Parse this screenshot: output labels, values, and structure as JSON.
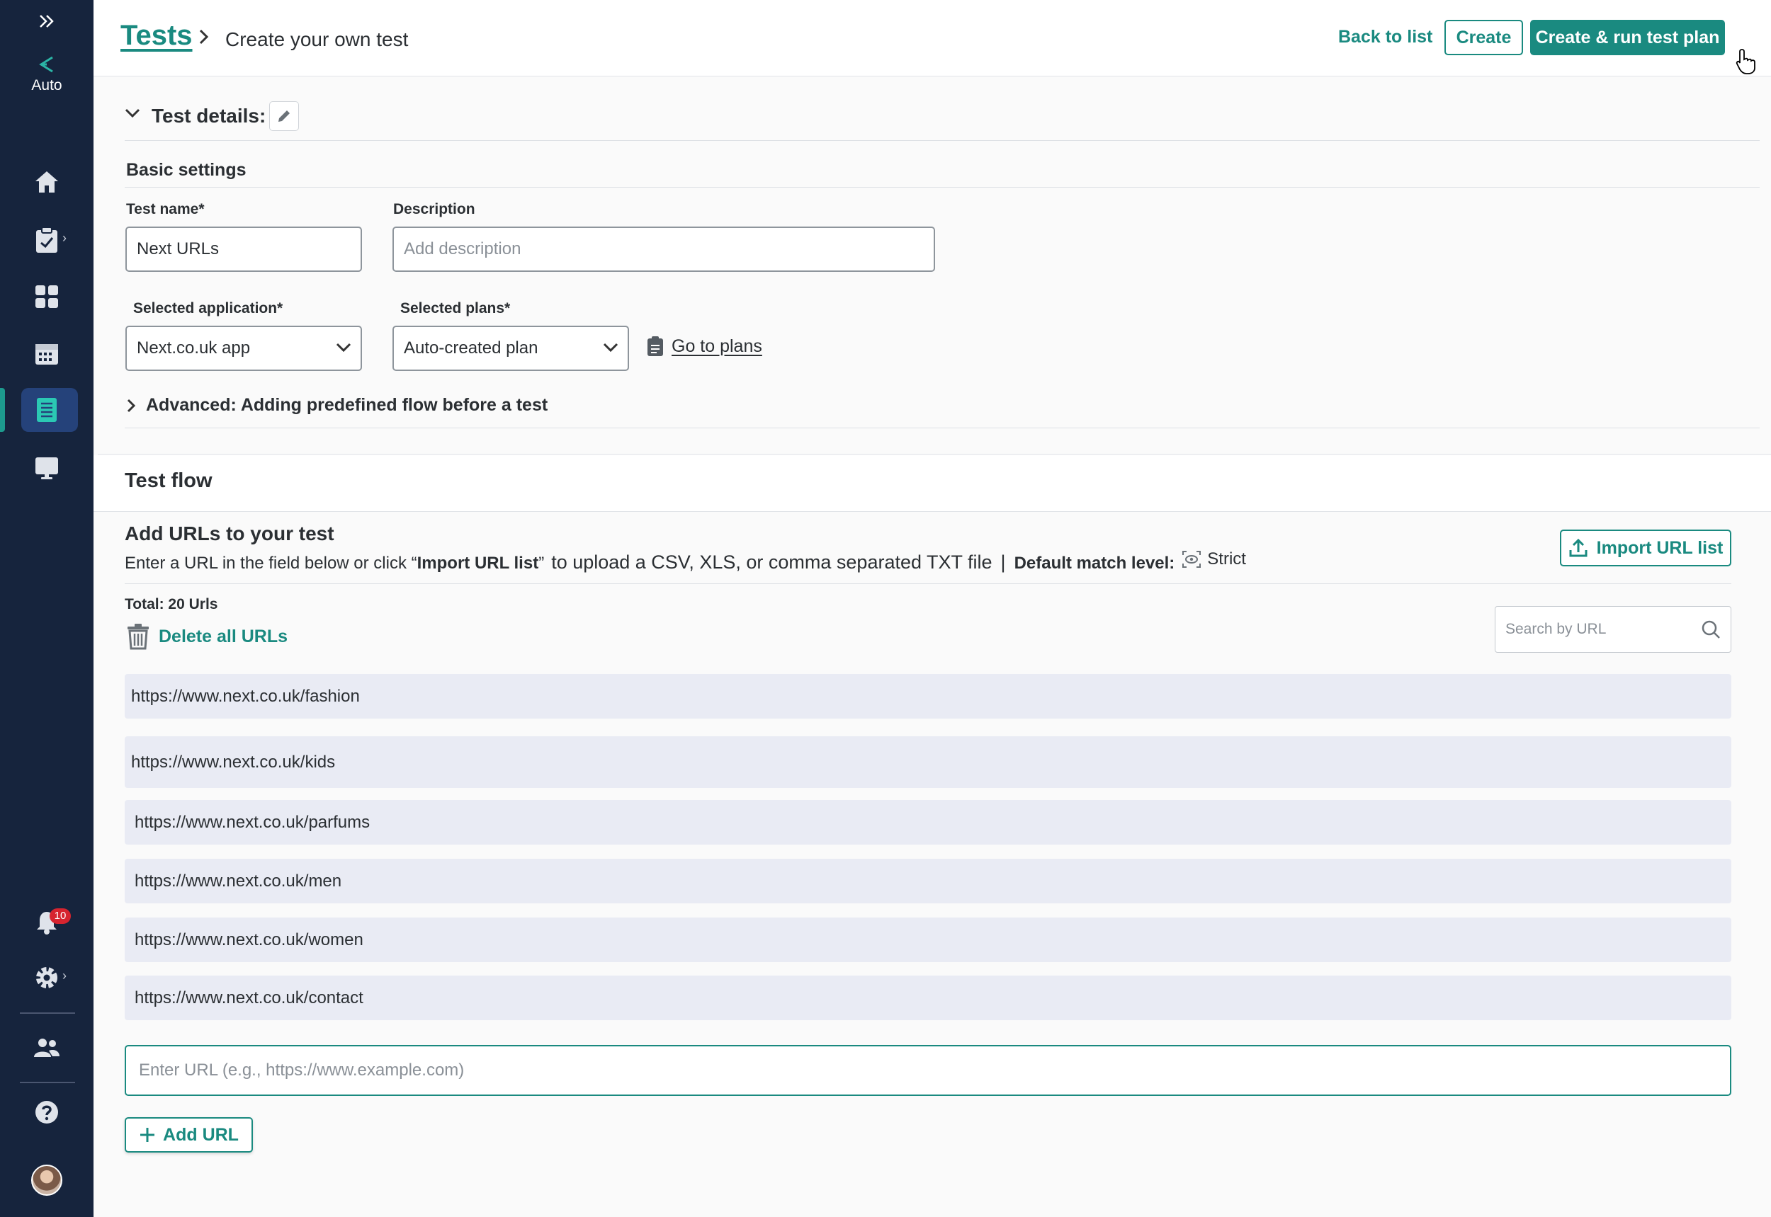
{
  "sidebar": {
    "expand_icon": "double-chevron-right-icon",
    "auto_label": "Auto",
    "notification_count": "10",
    "items": [
      {
        "icon": "home-icon"
      },
      {
        "icon": "clipboard-check-icon"
      },
      {
        "icon": "dashboard-grid-icon"
      },
      {
        "icon": "calendar-icon"
      },
      {
        "icon": "list-document-icon",
        "active": true
      },
      {
        "icon": "monitor-icon"
      }
    ],
    "bottom": [
      {
        "icon": "bell-icon"
      },
      {
        "icon": "gear-icon"
      },
      {
        "icon": "users-icon"
      },
      {
        "icon": "help-icon"
      },
      {
        "icon": "avatar"
      }
    ]
  },
  "header": {
    "breadcrumb_root": "Tests",
    "breadcrumb_current": "Create your own test",
    "back_label": "Back to list",
    "create_label": "Create",
    "create_run_label": "Create & run test plan"
  },
  "details": {
    "title": "Test details:",
    "basic_settings": "Basic settings",
    "test_name_label": "Test name*",
    "test_name_value": "Next URLs",
    "description_label": "Description",
    "description_placeholder": "Add description",
    "app_label": "Selected application*",
    "app_value": "Next.co.uk app",
    "plans_label": "Selected plans*",
    "plans_value": "Auto-created plan",
    "go_to_plans": "Go to plans",
    "advanced": "Advanced: Adding predefined flow before a test"
  },
  "flow": {
    "title": "Test flow",
    "add_title": "Add  URLs to your test",
    "instr_part1": "Enter a URL in the field below  or click “",
    "instr_bold": "Import URL list",
    "instr_part2": "”",
    "instr_part3": "to upload a CSV, XLS, or comma separated TXT file",
    "pipe": "|",
    "match_label": "Default match level:",
    "match_value": "Strict",
    "import_label": "Import URL list",
    "total": "Total: 20 Urls",
    "delete_all": "Delete all URLs",
    "search_placeholder": "Search by URL",
    "urls": [
      "https://www.next.co.uk/fashion",
      "https://www.next.co.uk/kids",
      "https://www.next.co.uk/parfums",
      "https://www.next.co.uk/men",
      "https://www.next.co.uk/women",
      "https://www.next.co.uk/contact"
    ],
    "enter_url_placeholder": "Enter URL (e.g., https://www.example.com)",
    "add_url_label": "Add URL"
  },
  "colors": {
    "accent": "#1a8a80",
    "sidebar": "#16243d",
    "sidebar_active": "#25427a",
    "url_row": "#e9ebf4",
    "badge": "#d6242f"
  }
}
